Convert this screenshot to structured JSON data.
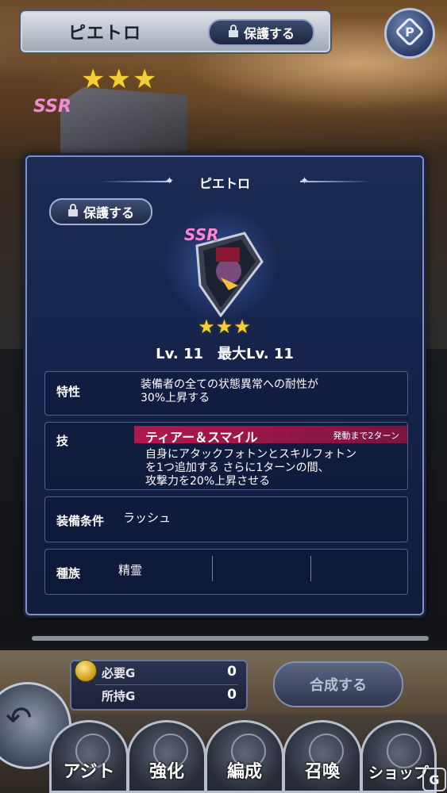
{
  "header": {
    "title": "ピエトロ",
    "protect_label": "保護する",
    "help_icon": "help-icon"
  },
  "background": {
    "stars": "★★★",
    "rarity": "SSR"
  },
  "panel": {
    "title": "ピエトロ",
    "protect_label": "保護する",
    "rarity": "SSR",
    "stars": "★★★",
    "level_text": "Lv. 11　最大Lv. 11",
    "trait": {
      "label": "特性",
      "line1": "装備者の全ての状態異常への耐性が",
      "line2": "30%上昇する"
    },
    "skill": {
      "label": "技",
      "name": "ティアー＆スマイル",
      "timer": "発動まで2ターン",
      "line1": "自身にアタックフォトンとスキルフォトン",
      "line2": "を1つ追加する さらに1ターンの間、",
      "line3": "攻撃力を20%上昇させる"
    },
    "equip": {
      "label": "装備条件",
      "value": "ラッシュ"
    },
    "race": {
      "label": "種族",
      "value": "精霊"
    }
  },
  "gold": {
    "required_label": "必要G",
    "required_value": "0",
    "owned_label": "所持G",
    "owned_value": "0"
  },
  "compose_label": "合成する",
  "nav": [
    {
      "label": "アジト",
      "icon": "bottle-icon"
    },
    {
      "label": "強化",
      "icon": "armor-icon"
    },
    {
      "label": "編成",
      "icon": "party-icon"
    },
    {
      "label": "召喚",
      "icon": "summon-circle-icon"
    },
    {
      "label": "ショップ",
      "icon": "shop-icon"
    }
  ],
  "colors": {
    "panel_bg": "#15234a",
    "accent_skill": "#b0184e",
    "star": "#f4cf3a",
    "ssr": "#f08ad4"
  }
}
